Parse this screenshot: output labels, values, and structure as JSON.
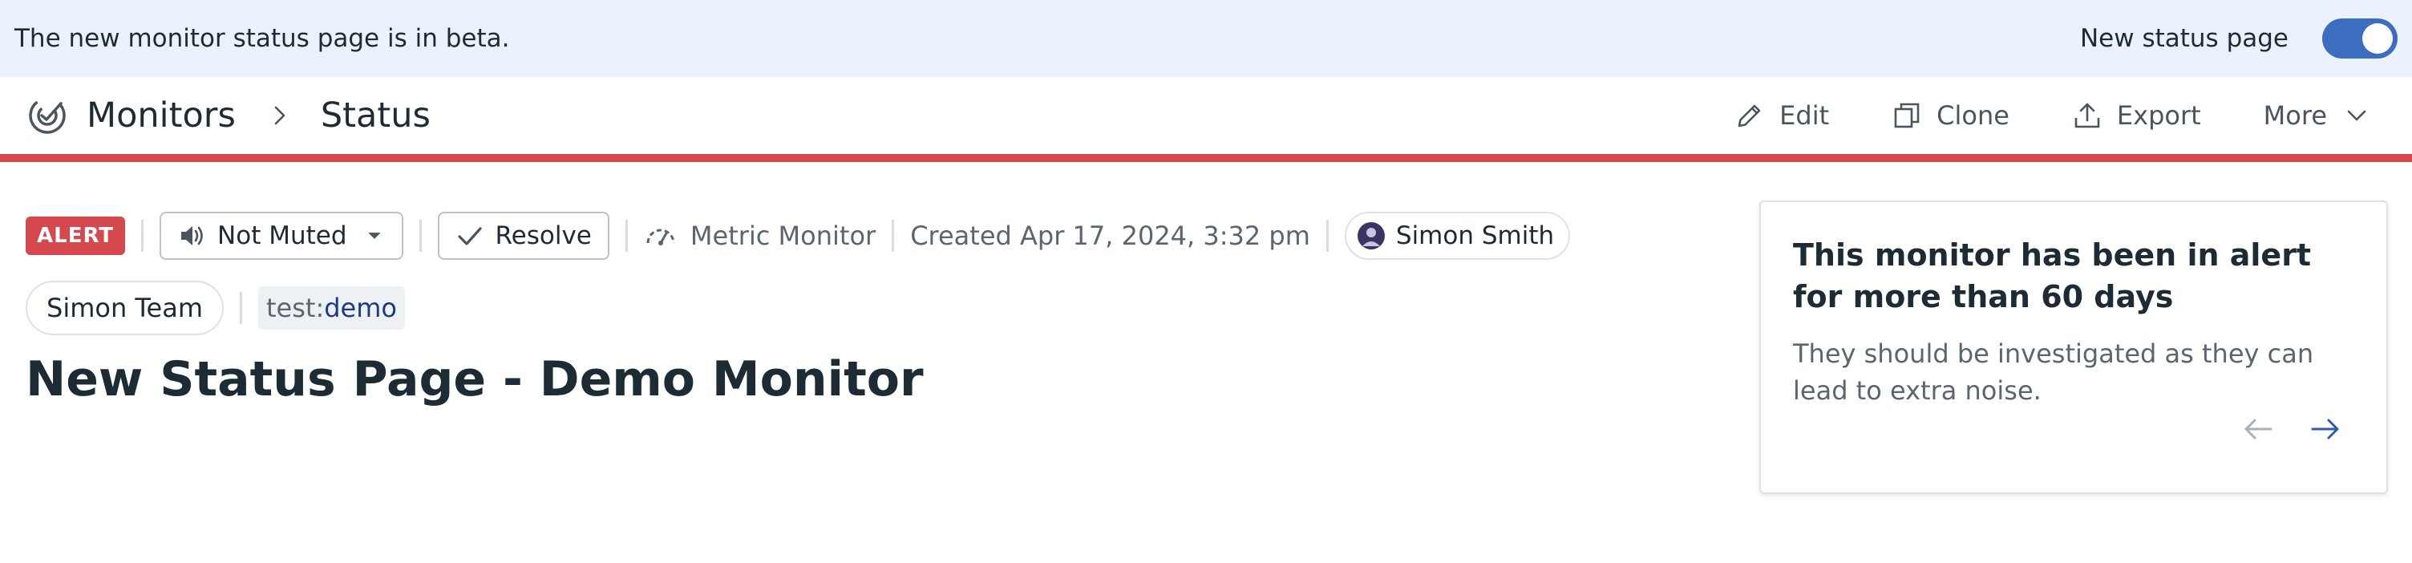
{
  "banner": {
    "text": "The new monitor status page is in beta.",
    "toggle_label": "New status page",
    "toggle_on": true
  },
  "header": {
    "breadcrumb": [
      "Monitors",
      "Status"
    ],
    "actions": {
      "edit": "Edit",
      "clone": "Clone",
      "export": "Export",
      "more": "More"
    },
    "status_color": "#d5484e"
  },
  "monitor": {
    "status": "ALERT",
    "mute_label": "Not Muted",
    "resolve_label": "Resolve",
    "type": "Metric Monitor",
    "created": "Created Apr 17, 2024, 3:32 pm",
    "owner": "Simon Smith",
    "team": "Simon Team",
    "tag": {
      "key": "test",
      "sep": ":",
      "value": "demo"
    },
    "title": "New Status Page - Demo Monitor"
  },
  "notice": {
    "title": "This monitor has been in alert for more than 60 days",
    "body": "They should be investigated as they can lead to extra noise."
  },
  "icons": {
    "monitors": "monitors-target-icon",
    "edit": "pencil-icon",
    "clone": "clone-icon",
    "export": "upload-icon",
    "more": "chevron-down-icon",
    "mute": "speaker-icon",
    "resolve": "check-icon",
    "monitor_type": "gauge-icon",
    "prev": "arrow-left-icon",
    "next": "arrow-right-icon"
  }
}
